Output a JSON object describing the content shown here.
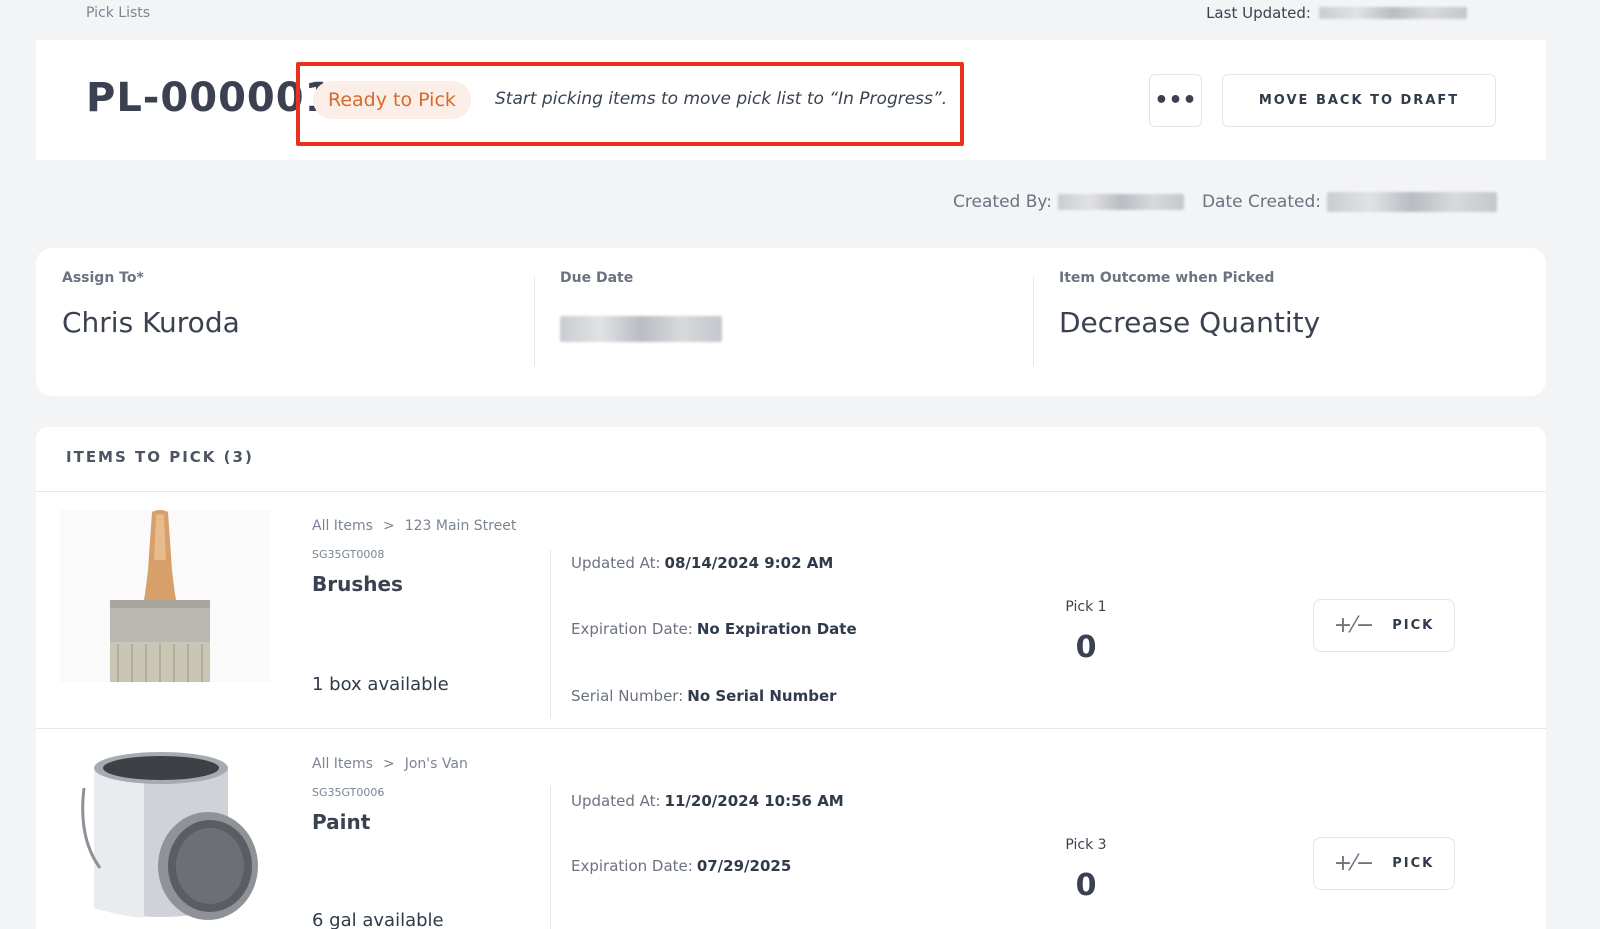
{
  "breadcrumb": "Pick Lists",
  "last_updated_label": "Last Updated:",
  "header": {
    "id": "PL-000001",
    "status": "Ready to Pick",
    "status_hint": "Start picking items to move pick list to “In Progress”.",
    "more_label": "•••",
    "move_back_label": "MOVE BACK TO DRAFT"
  },
  "meta": {
    "created_by_label": "Created By:",
    "date_created_label": "Date Created:"
  },
  "assignment": {
    "assign_label": "Assign To*",
    "assign_value": "Chris Kuroda",
    "due_label": "Due Date",
    "outcome_label": "Item Outcome when Picked",
    "outcome_value": "Decrease Quantity"
  },
  "items": {
    "title": "ITEMS TO PICK (3)",
    "rows": [
      {
        "crumb_root": "All Items",
        "crumb_chevron": ">",
        "location": "123 Main Street",
        "sku": "SG35GT0008",
        "name": "Brushes",
        "available": "1 box available",
        "updated_label": "Updated At:",
        "updated_value": "08/14/2024 9:02 AM",
        "expiration_label": "Expiration Date:",
        "expiration_value": "No Expiration Date",
        "serial_label": "Serial Number:",
        "serial_value": "No Serial Number",
        "pick_label": "Pick 1",
        "pick_count": "0",
        "pick_button": "PICK",
        "pick_icon": "+⁄−"
      },
      {
        "crumb_root": "All Items",
        "crumb_chevron": ">",
        "location": "Jon's Van",
        "sku": "SG35GT0006",
        "name": "Paint",
        "available": "6 gal available",
        "updated_label": "Updated At:",
        "updated_value": "11/20/2024 10:56 AM",
        "expiration_label": "Expiration Date:",
        "expiration_value": "07/29/2025",
        "pick_label": "Pick 3",
        "pick_count": "0",
        "pick_button": "PICK",
        "pick_icon": "+⁄−"
      }
    ]
  }
}
